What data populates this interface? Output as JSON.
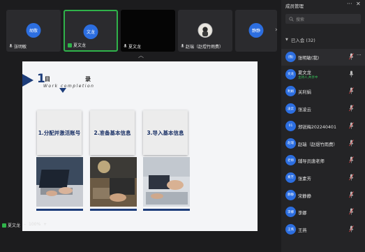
{
  "video_strip": {
    "tiles": [
      {
        "avatar": "胡敬",
        "name": "张明敏",
        "active": false,
        "black": false,
        "photo": false
      },
      {
        "avatar": "文龙",
        "name": "夏文龙",
        "active": true,
        "black": false,
        "photo": false
      },
      {
        "avatar": "",
        "name": "夏文龙",
        "active": false,
        "black": true,
        "photo": false
      },
      {
        "avatar": "",
        "name": "赵瑞（赵煜竹雨费）",
        "active": false,
        "black": false,
        "photo": true
      },
      {
        "avatar": "静静",
        "name": "",
        "active": false,
        "black": false,
        "photo": false
      }
    ],
    "collapse_icon": "chevron-up-icon",
    "next_icon": "chevron-right-icon"
  },
  "slide": {
    "number": "1",
    "title_part1": "目",
    "title_part2": "录",
    "subtitle": "Work completion",
    "cards": [
      "1.分配并激活账号",
      "2.准备基本信息",
      "3.导入基本信息"
    ]
  },
  "bottom_bar": {
    "presenter": "夏文龙",
    "zoom_minus": "–",
    "zoom_level": "100%",
    "zoom_plus": "+"
  },
  "panel": {
    "title": "成员管理",
    "more_icon": "more-icon",
    "close_icon": "close-icon",
    "search_placeholder": "搜索",
    "group_label": "已入会 (32)",
    "participants": [
      {
        "avatar": "(我)",
        "name": "张明敏(我)",
        "sub": "",
        "mic": true,
        "dots": true,
        "highlight": true
      },
      {
        "avatar": "文龙",
        "name": "夏文龙",
        "sub": "主持人,共享中",
        "mic": true,
        "dots": false,
        "highlight": false
      },
      {
        "avatar": "利娟",
        "name": "关利娟",
        "sub": "",
        "mic": true,
        "dots": false,
        "highlight": false
      },
      {
        "avatar": "凌云",
        "name": "张凌云",
        "sub": "",
        "mic": true,
        "dots": false,
        "highlight": false
      },
      {
        "avatar": "01",
        "name": "郑锐梅202240401",
        "sub": "",
        "mic": true,
        "dots": false,
        "highlight": false
      },
      {
        "avatar": "赵瑞",
        "name": "赵瑞（赵煜竹雨费）",
        "sub": "",
        "mic": true,
        "dots": false,
        "highlight": false
      },
      {
        "avatar": "老师",
        "name": "辅导员唐老师",
        "sub": "",
        "mic": true,
        "dots": false,
        "highlight": false
      },
      {
        "avatar": "素芳",
        "name": "张素芳",
        "sub": "",
        "mic": true,
        "dots": false,
        "highlight": false
      },
      {
        "avatar": "静静",
        "name": "宋静静",
        "sub": "",
        "mic": true,
        "dots": false,
        "highlight": false
      },
      {
        "avatar": "李娜",
        "name": "李娜",
        "sub": "",
        "mic": true,
        "dots": false,
        "highlight": false
      },
      {
        "avatar": "王燕",
        "name": "王燕",
        "sub": "",
        "mic": true,
        "dots": false,
        "highlight": false
      }
    ]
  },
  "colors": {
    "accent_green": "#2fb34a",
    "avatar_blue": "#2c6ee0",
    "slide_navy": "#1d3d7a"
  }
}
